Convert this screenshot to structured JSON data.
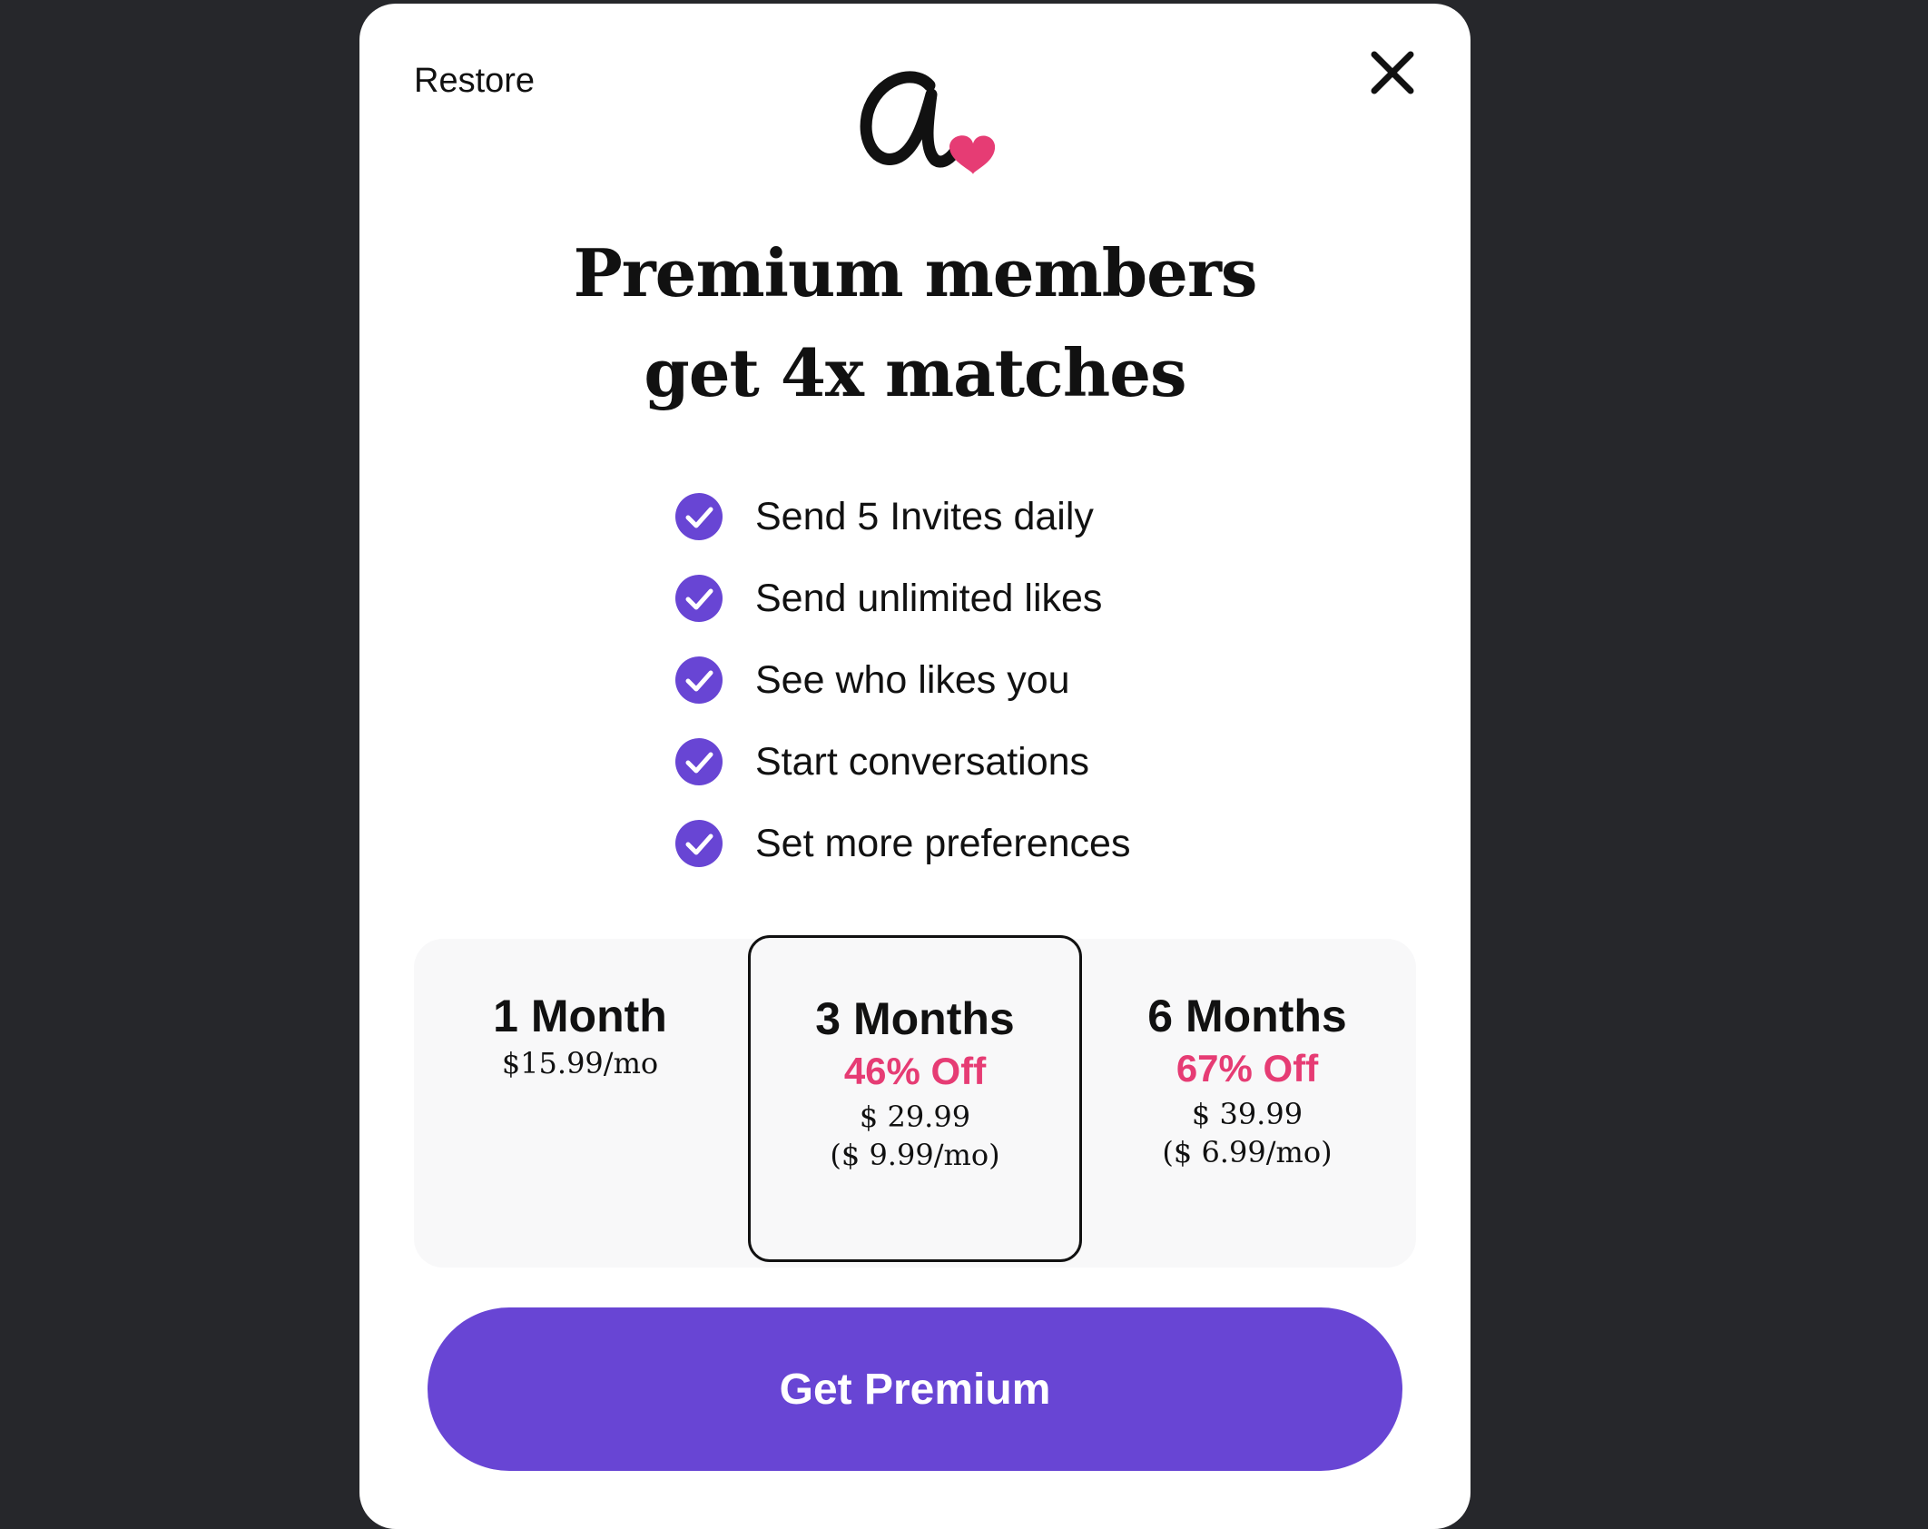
{
  "header": {
    "restore_label": "Restore"
  },
  "headline": {
    "line1": "Premium members",
    "line2": "get 4x matches"
  },
  "features": [
    {
      "label": "Send 5 Invites daily"
    },
    {
      "label": "Send unlimited likes"
    },
    {
      "label": "See who likes you"
    },
    {
      "label": "Start conversations"
    },
    {
      "label": "Set more preferences"
    }
  ],
  "plans": [
    {
      "title": "1 Month",
      "price": "$15.99/mo"
    },
    {
      "title": "3 Months",
      "discount": "46% Off",
      "price": "$ 29.99",
      "monthly": "($ 9.99/mo)",
      "selected": true
    },
    {
      "title": "6 Months",
      "discount": "67% Off",
      "price": "$ 39.99",
      "monthly": "($ 6.99/mo)"
    }
  ],
  "cta": {
    "label": "Get Premium"
  },
  "colors": {
    "accent": "#6845d4",
    "discount": "#e63c74",
    "heart": "#e63c74",
    "backdrop": "#26272b"
  },
  "icons": {
    "close": "close-icon",
    "logo": "logo-icon",
    "check": "check-circle-icon"
  }
}
